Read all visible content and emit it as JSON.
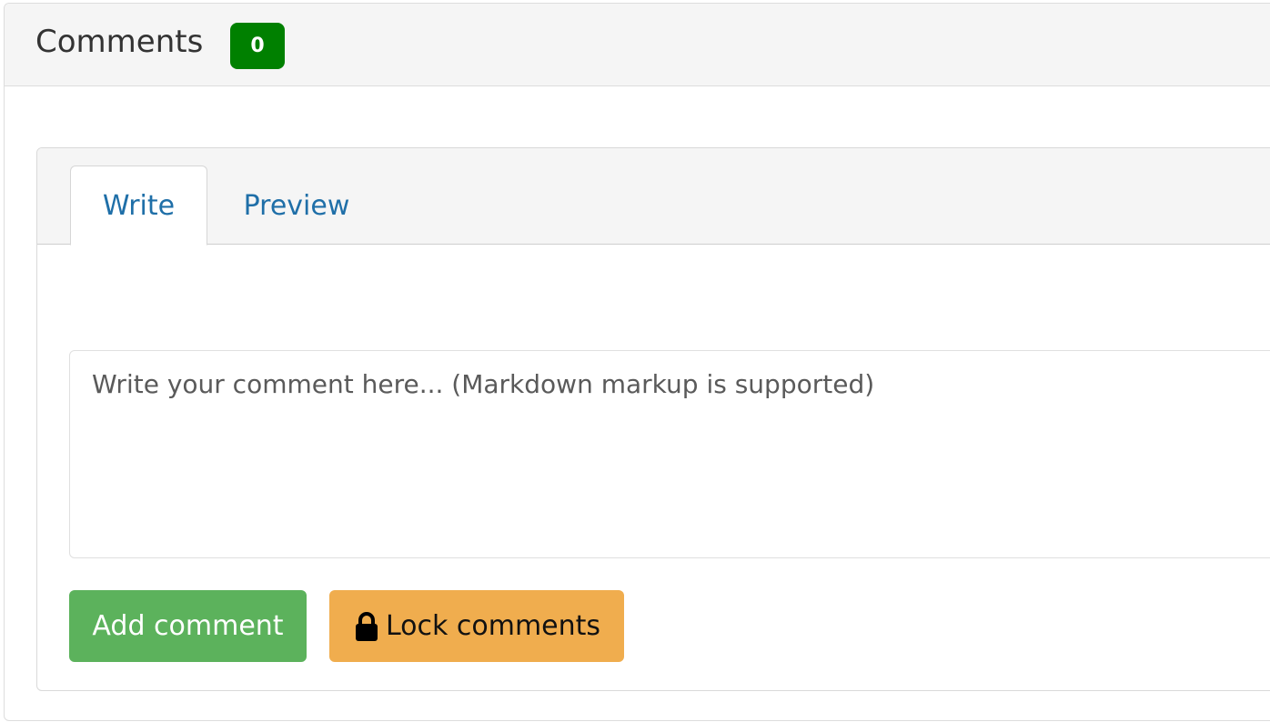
{
  "header": {
    "title": "Comments",
    "count": "0"
  },
  "tabs": [
    {
      "label": "Write",
      "active": true
    },
    {
      "label": "Preview",
      "active": false
    }
  ],
  "comment_input": {
    "value": "",
    "placeholder": "Write your comment here... (Markdown markup is supported)"
  },
  "actions": {
    "add_label": "Add comment",
    "lock_label": "Lock comments",
    "lock_icon": "lock-icon"
  },
  "colors": {
    "badge": "#008000",
    "add_button": "#5cb25c",
    "lock_button": "#f0ad4e",
    "link": "#1f6fa8"
  }
}
